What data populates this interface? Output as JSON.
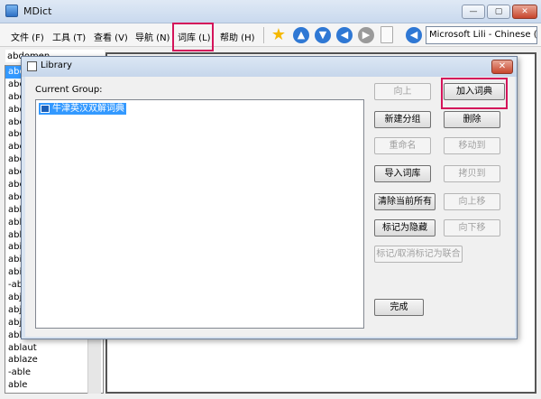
{
  "window": {
    "title": "MDict",
    "min_glyph": "—",
    "max_glyph": "▢",
    "close_glyph": "✕"
  },
  "menu": [
    "文件 (F)",
    "工具 (T)",
    "查看 (V)",
    "导航 (N)",
    "词库 (L)",
    "帮助 (H)"
  ],
  "toolbar": {
    "star_glyph": "★",
    "up_glyph": "▲",
    "down_glyph": "▼",
    "back_glyph": "◀",
    "forward_glyph": "▶",
    "lookup_glyph": "◀",
    "dict_selected": "Microsoft Lili - Chinese (C"
  },
  "search": {
    "value": "abdomen"
  },
  "word_list": [
    "abd",
    "abd",
    "abd",
    "abd",
    "abd",
    "abd",
    "abe",
    "abe",
    "abe",
    "abe",
    "abe",
    "abh",
    "abh",
    "abh",
    "abic",
    "abic",
    "abill",
    "-abi",
    "abje",
    "abju",
    "abju",
    "able",
    "ablaut",
    "ablaze",
    "-able",
    "able"
  ],
  "dialog": {
    "title": "Library",
    "close_glyph": "✕",
    "group_label": "Current Group:",
    "group_item": "牛津英汉双解词典",
    "buttons": {
      "move_up": "向上",
      "add_dict": "加入词典",
      "new_group": "新建分组",
      "delete": "删除",
      "rename": "重命名",
      "move_to": "移动到",
      "import": "导入词库",
      "copy_to": "拷贝到",
      "clear_all": "清除当前所有",
      "shift_up": "向上移",
      "mark_hidden": "标记为隐藏",
      "shift_down": "向下移",
      "toggle_union": "标记/取消标记为联合",
      "done": "完成"
    }
  }
}
